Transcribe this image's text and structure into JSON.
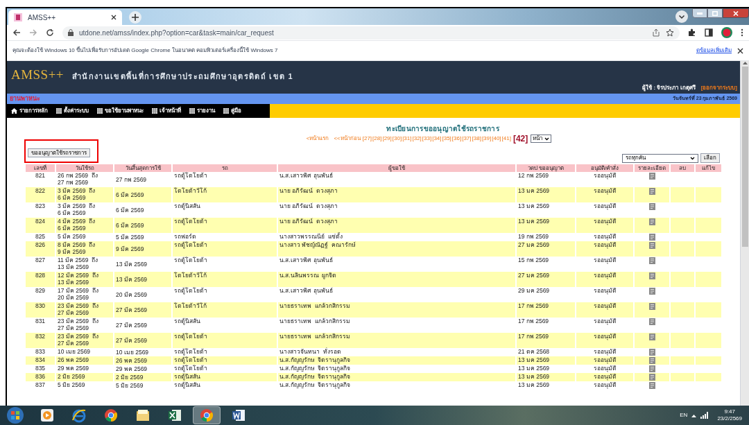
{
  "browser": {
    "tab_title": "AMSS++",
    "url": "utdone.net/amss/index.php?option=car&task=main/car_request",
    "infobar": {
      "message": "คุณจะต้องใช้ Windows 10 ขึ้นไปเพื่อรับการอัปเดต Google Chrome ในอนาคต คอมพิวเตอร์เครื่องนี้ใช้ Windows 7",
      "link": "ดูข้อมูลเพิ่มเติม"
    }
  },
  "header": {
    "logo": "AMSS++",
    "org": "สำนักงานเขตพื้นที่การศึกษาประถมศึกษาอุตรดิตถ์ เขต 1",
    "user": "ผู้ใช้ : จิรประภา เกตุศรี",
    "logout": "[ออกจากระบบ]",
    "section": "ยานพาหนะ",
    "date": "วันจันทร์ที่ 23 กุมภาพันธ์ 2569"
  },
  "menu": [
    {
      "label": "รายการหลัก",
      "kind": "home"
    },
    {
      "label": "ตั้งค่าระบบ",
      "kind": "grid"
    },
    {
      "label": "ขอใช้ยานพาหนะ",
      "kind": "grid"
    },
    {
      "label": "เจ้าหน้าที่",
      "kind": "grid"
    },
    {
      "label": "รายงาน",
      "kind": "grid"
    },
    {
      "label": "คู่มือ",
      "kind": "grid"
    }
  ],
  "page": {
    "title": "ทะเบียนการขออนุญาตใช้รถราชการ",
    "first": "<หน้าแรก",
    "prev": "<<หน้าก่อน",
    "pages": [
      {
        "label": "[27]",
        "selected": false
      },
      {
        "label": "[28]",
        "selected": false
      },
      {
        "label": "[29]",
        "selected": false
      },
      {
        "label": "[30]",
        "selected": false
      },
      {
        "label": "[31]",
        "selected": false
      },
      {
        "label": "[32]",
        "selected": false
      },
      {
        "label": "[33]",
        "selected": false
      },
      {
        "label": "[34]",
        "selected": false
      },
      {
        "label": "[35]",
        "selected": false
      },
      {
        "label": "[36]",
        "selected": false
      },
      {
        "label": "[37]",
        "selected": false
      },
      {
        "label": "[38]",
        "selected": false
      },
      {
        "label": "[39]",
        "selected": false
      },
      {
        "label": "[40]",
        "selected": false
      },
      {
        "label": "[41]",
        "selected": false
      },
      {
        "label": "[42]",
        "selected": true
      }
    ],
    "page_select": "หน้า",
    "request_button": "ขออนุญาตใช้รถราชการ",
    "car_filter": "รถทุกคัน",
    "filter_button": "เลือก"
  },
  "table": {
    "columns": [
      "เลขที่",
      "วันใช้รถ",
      "วันสิ้นสุดการใช้",
      "รถ",
      "ผู้ขอใช้",
      "วดป ขออนุญาต",
      "อนุมัติ/คำสั่ง",
      "รายละเอียด",
      "ลบ",
      "แก้ไข"
    ],
    "rows": [
      {
        "no": "821",
        "use_date": [
          "26 กพ 2569  ถึง",
          "27 กพ 2569"
        ],
        "end": "27 กพ 2569",
        "car": "รถตู้โตโยต้า",
        "requester": "น.ส.เสาวพิศ  อุนพันธ์",
        "request_date": "12 กพ 2569",
        "status": "รออนุมัติ"
      },
      {
        "no": "822",
        "use_date": [
          "3 มีค 2569  ถึง",
          "6 มีค 2569"
        ],
        "end": "6 มีค 2569",
        "car": "โตโยต้าวีโก้",
        "requester": "นาย อภิรัฒน์  ดวงสุภา",
        "request_date": "13 มค 2569",
        "status": "รออนุมัติ"
      },
      {
        "no": "823",
        "use_date": [
          "3 มีค 2569  ถึง",
          "6 มีค 2569"
        ],
        "end": "6 มีค 2569",
        "car": "รถตู้นิสสัน",
        "requester": "นาย อภิรัฒน์  ดวงสุภา",
        "request_date": "13 มค 2569",
        "status": "รออนุมัติ"
      },
      {
        "no": "824",
        "use_date": [
          "4 มีค 2569  ถึง",
          "6 มีค 2569"
        ],
        "end": "6 มีค 2569",
        "car": "รถตู้โตโยต้า",
        "requester": "นาย อภิรัฒน์  ดวงสุภา",
        "request_date": "13 มค 2569",
        "status": "รออนุมัติ"
      },
      {
        "no": "825",
        "use_date": [
          "5 มีค 2569"
        ],
        "end": "5 มีค 2569",
        "car": "รถฟอร์ด",
        "requester": "นางสาวพรรณนีย์  แซ่ตั้ง",
        "request_date": "19 กพ 2569",
        "status": "รออนุมัติ"
      },
      {
        "no": "826",
        "use_date": [
          "8 มีค 2569  ถึง",
          "9 มีค 2569"
        ],
        "end": "9 มีค 2569",
        "car": "รถตู้โตโยต้า",
        "requester": "นางสาว พัชญ์ณัฏฐ์  คณารักษ์",
        "request_date": "27 มค 2569",
        "status": "รออนุมัติ"
      },
      {
        "no": "827",
        "use_date": [
          "11 มีค 2569  ถึง",
          "13 มีค 2569"
        ],
        "end": "13 มีค 2569",
        "car": "รถตู้โตโยต้า",
        "requester": "น.ส.เสาวพิศ  อุนพันธ์",
        "request_date": "15 กพ 2569",
        "status": "รออนุมัติ"
      },
      {
        "no": "828",
        "use_date": [
          "12 มีค 2569  ถึง",
          "13 มีค 2569"
        ],
        "end": "13 มีค 2569",
        "car": "โตโยต้าวีโก้",
        "requester": "น.ส.นลินพรรณ  ผูกจิต",
        "request_date": "27 มค 2569",
        "status": "รออนุมัติ"
      },
      {
        "no": "829",
        "use_date": [
          "17 มีค 2569  ถึง",
          "20 มีค 2569"
        ],
        "end": "20 มีค 2569",
        "car": "รถตู้โตโยต้า",
        "requester": "น.ส.เสาวพิศ  อุนพันธ์",
        "request_date": "29 มค 2569",
        "status": "รออนุมัติ"
      },
      {
        "no": "830",
        "use_date": [
          "23 มีค 2569  ถึง",
          "27 มีค 2569"
        ],
        "end": "27 มีค 2569",
        "car": "โตโยต้าวีโก้",
        "requester": "นายธราเทพ  แกล้วกสิกรรม",
        "request_date": "17 กพ 2569",
        "status": "รออนุมัติ"
      },
      {
        "no": "831",
        "use_date": [
          "23 มีค 2569  ถึง",
          "27 มีค 2569"
        ],
        "end": "27 มีค 2569",
        "car": "รถตู้นิสสัน",
        "requester": "นายธราเทพ  แกล้วกสิกรรม",
        "request_date": "17 กพ 2569",
        "status": "รออนุมัติ"
      },
      {
        "no": "832",
        "use_date": [
          "23 มีค 2569  ถึง",
          "27 มีค 2569"
        ],
        "end": "27 มีค 2569",
        "car": "รถตู้โตโยต้า",
        "requester": "นายธราเทพ  แกล้วกสิกรรม",
        "request_date": "17 กพ 2569",
        "status": "รออนุมัติ"
      },
      {
        "no": "833",
        "use_date": [
          "10 เมย 2569"
        ],
        "end": "10 เมย 2569",
        "car": "รถตู้โตโยต้า",
        "requester": "นางสาวจันทนา  ทั่งรอด",
        "request_date": "21 ตค 2568",
        "status": "รออนุมัติ"
      },
      {
        "no": "834",
        "use_date": [
          "26 พค 2569"
        ],
        "end": "26 พค 2569",
        "car": "รถตู้โตโยต้า",
        "requester": "น.ส.กัญญรักษ  จิตรานุกูลกิจ",
        "request_date": "13 มค 2569",
        "status": "รออนุมัติ"
      },
      {
        "no": "835",
        "use_date": [
          "29 พค 2569"
        ],
        "end": "29 พค 2569",
        "car": "รถตู้โตโยต้า",
        "requester": "น.ส.กัญญรักษ  จิตรานุกูลกิจ",
        "request_date": "13 มค 2569",
        "status": "รออนุมัติ"
      },
      {
        "no": "836",
        "use_date": [
          "2 มิย 2569"
        ],
        "end": "2 มิย 2569",
        "car": "รถตู้นิสสัน",
        "requester": "น.ส.กัญญรักษ  จิตรานุกูลกิจ",
        "request_date": "13 มค 2569",
        "status": "รออนุมัติ"
      },
      {
        "no": "837",
        "use_date": [
          "5 มิย 2569"
        ],
        "end": "5 มิย 2569",
        "car": "รถตู้นิสสัน",
        "requester": "น.ส.กัญญรักษ  จิตรานุกูลกิจ",
        "request_date": "13 มค 2569",
        "status": "รออนุมัติ"
      }
    ]
  },
  "taskbar": {
    "apps": [
      {
        "kind": "media",
        "active": false
      },
      {
        "kind": "ie",
        "active": false
      },
      {
        "kind": "chrome",
        "active": false
      },
      {
        "kind": "folder",
        "active": false
      },
      {
        "kind": "excel",
        "active": false
      },
      {
        "kind": "chrome",
        "active": true
      },
      {
        "kind": "word",
        "active": false
      }
    ],
    "lang": "EN",
    "time": "9:47",
    "date": "23/2/2569"
  }
}
